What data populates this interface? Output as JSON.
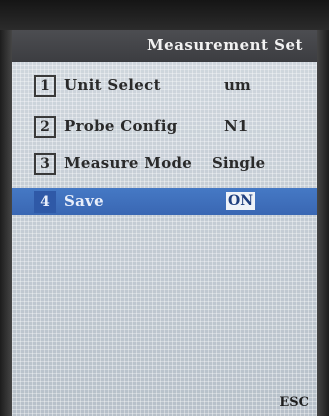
{
  "header": {
    "title": "Measurement Set"
  },
  "menu": {
    "items": [
      {
        "number": "1",
        "label": "Unit Select",
        "value": "um"
      },
      {
        "number": "2",
        "label": "Probe Config",
        "value": "N1"
      },
      {
        "number": "3",
        "label": "Measure Mode",
        "value": "Single"
      },
      {
        "number": "4",
        "label": "Save",
        "value": "ON"
      }
    ],
    "selected_index": 3
  },
  "footer": {
    "esc_label": "ESC"
  },
  "colors": {
    "title_bar": "#444549",
    "screen_bg": "#c2cbd4",
    "selection": "#3f70bd",
    "text_dark": "#2a2a2a"
  }
}
